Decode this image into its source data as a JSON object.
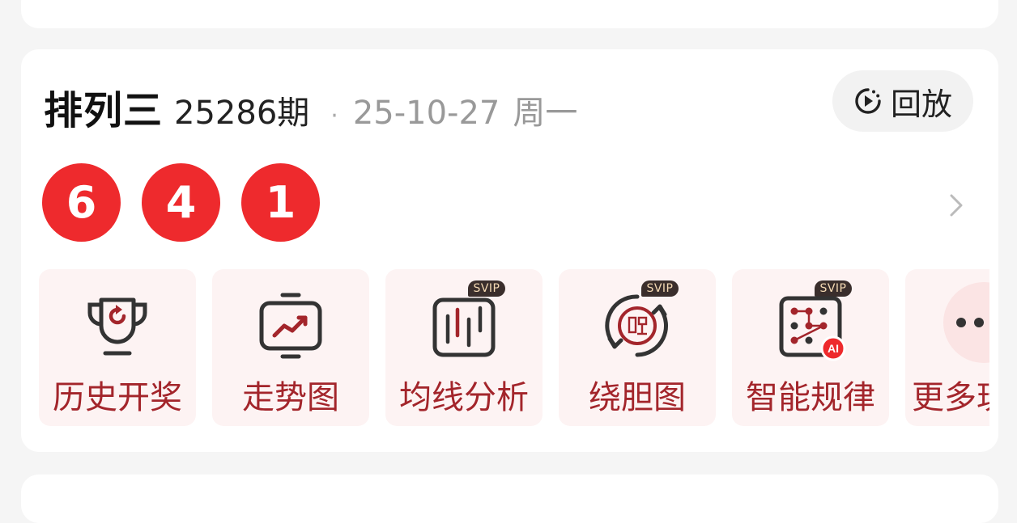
{
  "header": {
    "lottery_name": "排列三",
    "issue": "25286期",
    "separator": "·",
    "date": "25-10-27",
    "weekday": "周一",
    "replay_label": "回放",
    "replay_icon": "replay-icon"
  },
  "draw": {
    "numbers": [
      "6",
      "4",
      "1"
    ],
    "ball_color": "#ee2a2d",
    "detail_icon": "chevron-right-icon"
  },
  "tools": [
    {
      "label": "历史开奖",
      "icon": "trophy-icon",
      "svip": ""
    },
    {
      "label": "走势图",
      "icon": "trend-chart-icon",
      "svip": ""
    },
    {
      "label": "均线分析",
      "icon": "candlestick-icon",
      "svip": "SVIP"
    },
    {
      "label": "绕胆图",
      "icon": "cycle-dan-icon",
      "svip": "SVIP"
    },
    {
      "label": "智能规律",
      "icon": "ai-pattern-icon",
      "svip": "SVIP"
    },
    {
      "label": "更多玩法",
      "icon": "more-icon",
      "svip": ""
    }
  ],
  "colors": {
    "accent": "#a3252b",
    "tile_bg": "#fdf3f3",
    "svip_bg": "#3a2e2c"
  }
}
